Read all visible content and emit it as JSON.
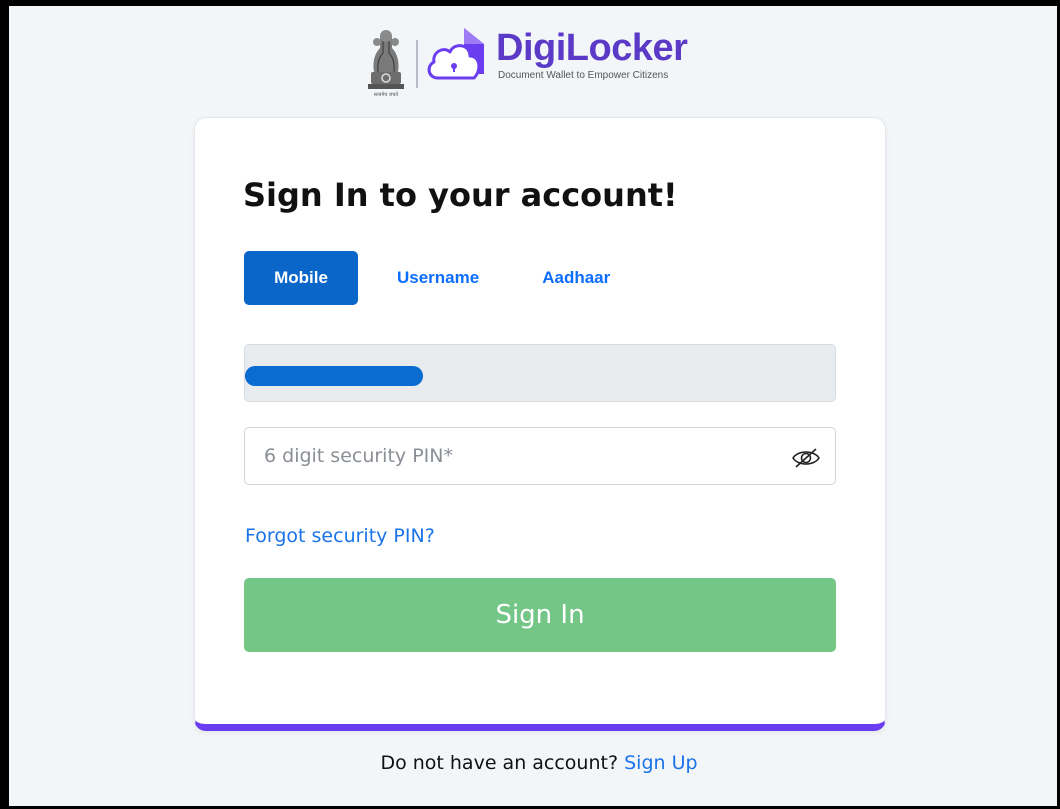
{
  "header": {
    "brand_name": "DigiLocker",
    "brand_tagline": "Document Wallet to Empower Citizens",
    "emblem_caption": "सत्यमेव जयते",
    "icons": {
      "emblem": "national-emblem-icon",
      "brand": "digilocker-cloud-icon"
    }
  },
  "card": {
    "title": "Sign In to your account!",
    "tabs": [
      {
        "label": "Mobile",
        "active": true
      },
      {
        "label": "Username",
        "active": false
      },
      {
        "label": "Aadhaar",
        "active": false
      }
    ],
    "mobile_field": {
      "value_redacted": true
    },
    "pin_field": {
      "placeholder": "6 digit security PIN*",
      "value": "",
      "toggle_icon": "eye-slash-icon"
    },
    "forgot_link": "Forgot security PIN?",
    "signin_button": "Sign In"
  },
  "footer": {
    "signup_prompt": "Do not have an account?",
    "signup_link": "Sign Up"
  },
  "colors": {
    "page_bg": "#f3f6f8",
    "primary_blue": "#0b66c9",
    "link_blue": "#1a73e8",
    "brand_purple": "#5b3ac7",
    "card_accent": "#6b3df0",
    "signin_green": "#74c686"
  }
}
